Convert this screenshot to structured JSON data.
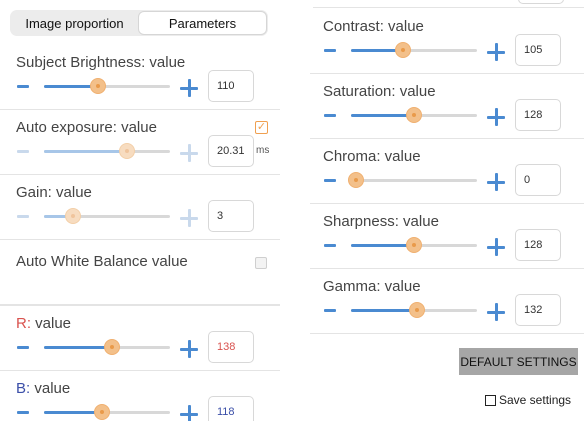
{
  "tabs": [
    {
      "label": "Image proportion",
      "active": false
    },
    {
      "label": "Parameters",
      "active": true
    }
  ],
  "left_controls": [
    {
      "id": "subject-brightness",
      "label": "Subject Brightness:  value",
      "value": "110",
      "fraction": 0.43,
      "enabled": true
    },
    {
      "id": "auto-exposure",
      "label": "Auto exposure:  value",
      "value": "20.31",
      "unit": "ms",
      "fraction": 0.66,
      "enabled": false,
      "checkbox_checked": true
    },
    {
      "id": "gain",
      "label": "Gain:  value",
      "value": "3",
      "fraction": 0.23,
      "enabled": false
    },
    {
      "id": "auto-white-balance",
      "label": "Auto White Balance  value",
      "checkbox_checked": false
    },
    {
      "id": "r",
      "prefix": "R:",
      "label": "  value",
      "value": "138",
      "fraction": 0.54,
      "enabled": true
    },
    {
      "id": "b",
      "prefix": "B:",
      "label": "  value",
      "value": "118",
      "fraction": 0.46,
      "enabled": true
    }
  ],
  "right_controls": [
    {
      "id": "contrast",
      "label": "Contrast:  value",
      "value": "105",
      "fraction": 0.41,
      "enabled": true
    },
    {
      "id": "saturation",
      "label": "Saturation:  value",
      "value": "128",
      "fraction": 0.5,
      "enabled": true
    },
    {
      "id": "chroma",
      "label": "Chroma:  value",
      "value": "0",
      "fraction": 0.04,
      "enabled": true
    },
    {
      "id": "sharpness",
      "label": "Sharpness:  value",
      "value": "128",
      "fraction": 0.5,
      "enabled": true
    },
    {
      "id": "gamma",
      "label": "Gamma:  value",
      "value": "132",
      "fraction": 0.52,
      "enabled": true
    }
  ],
  "default_settings_label": "DEFAULT SETTINGS",
  "save_settings_label": "Save settings",
  "save_settings_checked": false,
  "colors": {
    "accent": "#4a8ad1",
    "thumb": "#f3c08a",
    "red": "#d9534f",
    "blue": "#3b4fa8"
  }
}
